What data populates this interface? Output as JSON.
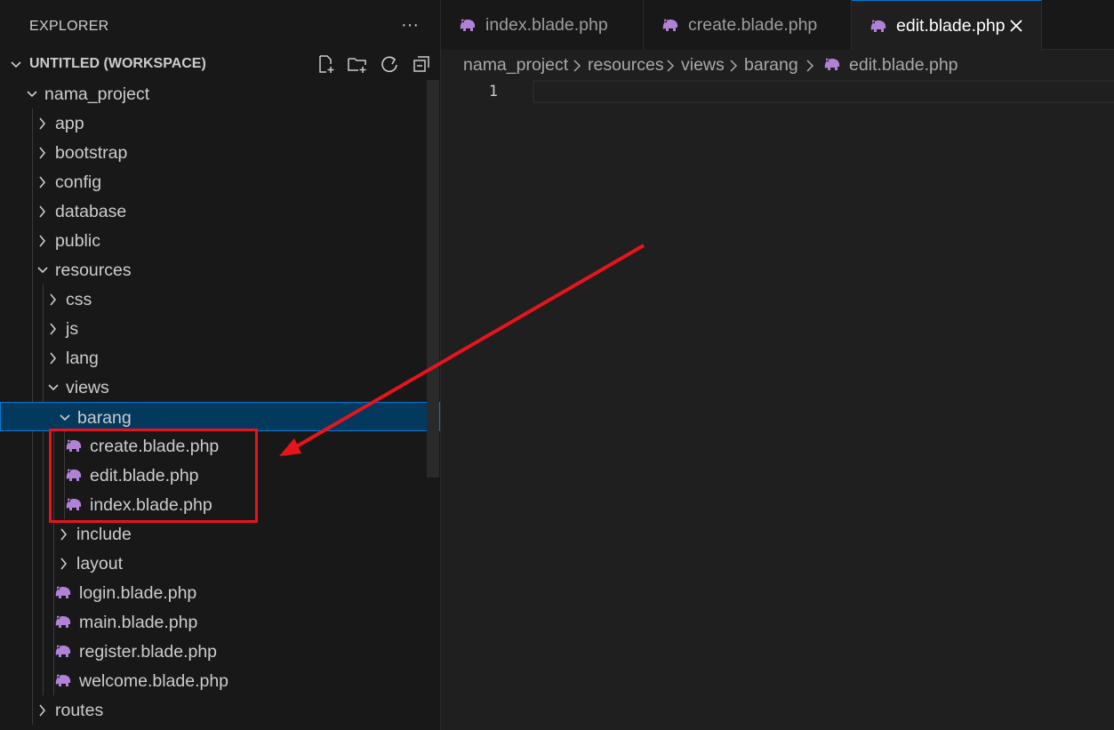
{
  "explorer": {
    "title": "EXPLORER",
    "more_glyph": "···",
    "workspace": {
      "label": "UNTITLED (WORKSPACE)",
      "actions": [
        "new-file-icon",
        "new-folder-icon",
        "refresh-icon",
        "collapse-all-icon"
      ]
    },
    "tree": [
      {
        "label": "nama_project",
        "type": "folder",
        "expanded": true
      },
      {
        "label": "app",
        "type": "folder",
        "expanded": false
      },
      {
        "label": "bootstrap",
        "type": "folder",
        "expanded": false
      },
      {
        "label": "config",
        "type": "folder",
        "expanded": false
      },
      {
        "label": "database",
        "type": "folder",
        "expanded": false
      },
      {
        "label": "public",
        "type": "folder",
        "expanded": false
      },
      {
        "label": "resources",
        "type": "folder",
        "expanded": true
      },
      {
        "label": "css",
        "type": "folder",
        "expanded": false
      },
      {
        "label": "js",
        "type": "folder",
        "expanded": false
      },
      {
        "label": "lang",
        "type": "folder",
        "expanded": false
      },
      {
        "label": "views",
        "type": "folder",
        "expanded": true
      },
      {
        "label": "barang",
        "type": "folder",
        "expanded": true,
        "selected": true
      },
      {
        "label": "create.blade.php",
        "type": "file"
      },
      {
        "label": "edit.blade.php",
        "type": "file"
      },
      {
        "label": "index.blade.php",
        "type": "file"
      },
      {
        "label": "include",
        "type": "folder",
        "expanded": false
      },
      {
        "label": "layout",
        "type": "folder",
        "expanded": false
      },
      {
        "label": "login.blade.php",
        "type": "file"
      },
      {
        "label": "main.blade.php",
        "type": "file"
      },
      {
        "label": "register.blade.php",
        "type": "file"
      },
      {
        "label": "welcome.blade.php",
        "type": "file"
      },
      {
        "label": "routes",
        "type": "folder",
        "expanded": false
      }
    ]
  },
  "tabs": [
    {
      "label": "index.blade.php",
      "active": false
    },
    {
      "label": "create.blade.php",
      "active": false
    },
    {
      "label": "edit.blade.php",
      "active": true
    }
  ],
  "breadcrumb": [
    "nama_project",
    "resources",
    "views",
    "barang",
    "edit.blade.php"
  ],
  "editor": {
    "line_numbers": [
      "1"
    ]
  },
  "colors": {
    "blade_icon": "#b180d7",
    "selection_bg": "#04395e",
    "selection_border": "#0078d4",
    "annotation_red": "#e8141c"
  }
}
